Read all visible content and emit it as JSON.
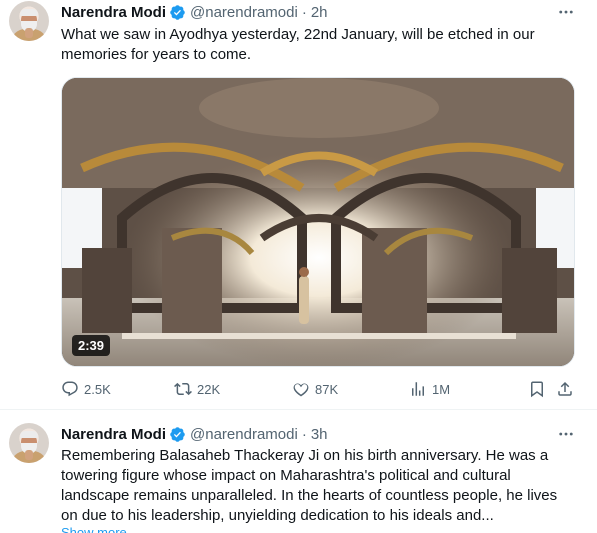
{
  "tweets": [
    {
      "author": "Narendra Modi",
      "handle": "@narendramodi",
      "separator": "·",
      "time": "2h",
      "text": "What we saw in Ayodhya yesterday, 22nd January, will be etched in our memories for years to come.",
      "video_duration": "2:39",
      "stats": {
        "replies": "2.5K",
        "reposts": "22K",
        "likes": "87K",
        "views": "1M"
      }
    },
    {
      "author": "Narendra Modi",
      "handle": "@narendramodi",
      "separator": "·",
      "time": "3h",
      "text_lines": [
        "Remembering Balasaheb Thackeray Ji on his birth anniversary. He was a",
        "towering figure whose impact on Maharashtra's political and cultural",
        "landscape remains unparalleled. In the hearts of countless people, he lives",
        "on due to his leadership, unyielding dedication to his ideals and..."
      ],
      "show_more": "Show more"
    }
  ],
  "colors": {
    "accent": "#1d9bf0",
    "muted": "#536471",
    "text": "#0f1419",
    "divider": "#eff3f4"
  },
  "icons": [
    "verified-badge-icon",
    "more-icon",
    "reply-icon",
    "repost-icon",
    "like-icon",
    "views-icon",
    "bookmark-icon",
    "share-icon"
  ]
}
